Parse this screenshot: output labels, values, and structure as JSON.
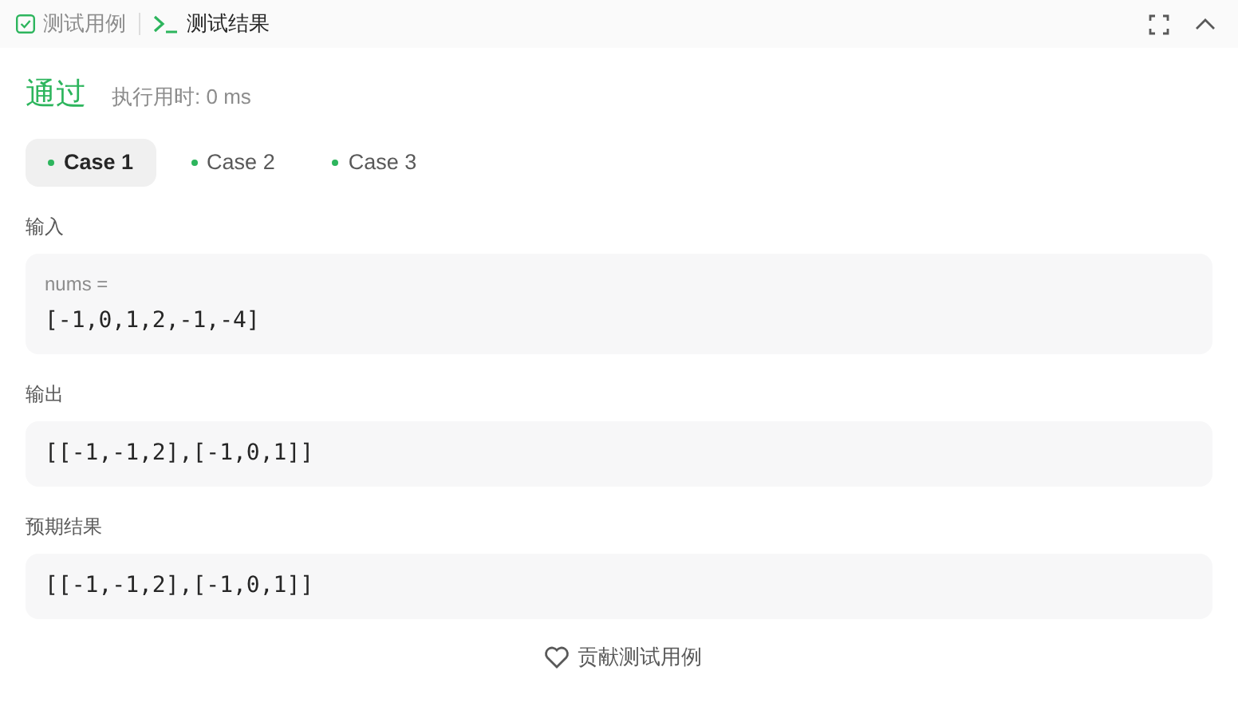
{
  "header_tabs": [
    {
      "label": "测试用例",
      "selected": false,
      "kind": "checkbox"
    },
    {
      "label": "测试结果",
      "selected": true,
      "kind": "terminal"
    }
  ],
  "result": {
    "status": "通过",
    "runtime": "执行用时: 0 ms"
  },
  "cases": [
    {
      "label": "Case 1",
      "selected": true
    },
    {
      "label": "Case 2",
      "selected": false
    },
    {
      "label": "Case 3",
      "selected": false
    }
  ],
  "sections": [
    {
      "label": "输入",
      "params": [
        {
          "name": "nums =",
          "value": "[-1,0,1,2,-1,-4]"
        }
      ]
    },
    {
      "label": "输出",
      "value": "[[-1,-1,2],[-1,0,1]]"
    },
    {
      "label": "预期结果",
      "value": "[[-1,-1,2],[-1,0,1]]"
    }
  ],
  "contribute_button": "贡献测试用例"
}
